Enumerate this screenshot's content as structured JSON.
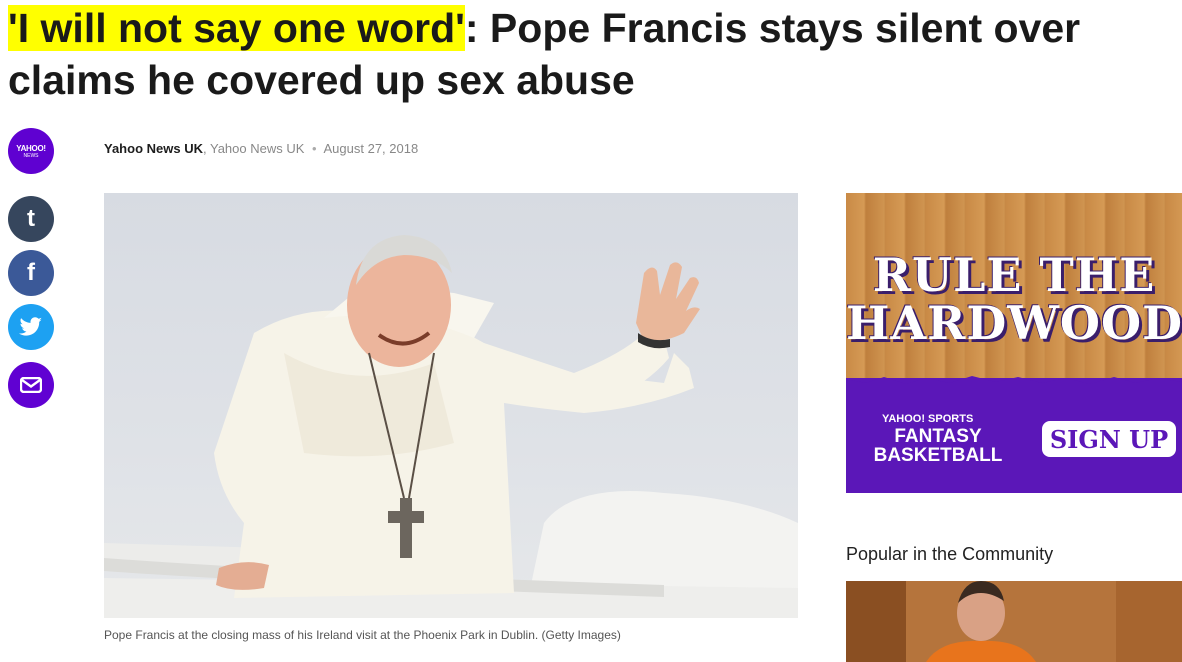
{
  "article": {
    "headline_quote": "'I will not say one word'",
    "headline_rest": ": Pope Francis stays silent over claims he covered up sex abuse",
    "avatar_text_top": "YAHOO!",
    "avatar_text_bottom": "NEWS",
    "author": "Yahoo News UK",
    "comma": ",",
    "source": "Yahoo News UK",
    "dot": "•",
    "date": "August 27, 2018",
    "caption": "Pope Francis at the closing mass of his Ireland visit at the Phoenix Park in Dublin. (Getty Images)"
  },
  "share": {
    "tumblr_label": "t",
    "facebook_label": "f"
  },
  "ad": {
    "headline": "RULE THE HARDWOOD",
    "sponsor": "YAHOO! SPORTS",
    "product_line1": "FANTASY",
    "product_line2": "BASKETBALL",
    "cta": "SIGN UP"
  },
  "sidebar": {
    "popular_title": "Popular in the Community"
  },
  "colors": {
    "highlight": "#ffff00",
    "yahoo_purple": "#5f01d1",
    "tumblr": "#36465d",
    "facebook": "#3b5998",
    "twitter": "#1da1f2"
  }
}
